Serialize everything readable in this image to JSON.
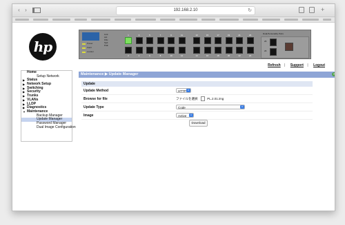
{
  "browser": {
    "url": "192.168.2.10",
    "back_icon": "chevron-left-icon",
    "forward_icon": "chevron-right-icon",
    "reload_icon": "reload-icon"
  },
  "header": {
    "logo_text": "hp",
    "switch_labels": {
      "mode_lines": [
        "Link",
        "Act",
        "FDx",
        "Spd",
        "PoE"
      ],
      "led_labels": [
        "Power",
        "Fault",
        "Locator"
      ],
      "sfp_title": "Dual-Personality Ports",
      "sfp_ports": [
        "25",
        "26"
      ]
    },
    "port_numbers_top": [
      "1",
      "3",
      "5",
      "7",
      "9",
      "11",
      "13",
      "15",
      "17",
      "19",
      "21",
      "23"
    ],
    "port_numbers_bottom": [
      "2",
      "4",
      "6",
      "8",
      "10",
      "12",
      "14",
      "16",
      "18",
      "20",
      "22",
      "24"
    ],
    "active_port": "1"
  },
  "top_links": {
    "refresh": "Refresh",
    "support": "Support",
    "logout": "Logout"
  },
  "nav": {
    "items": [
      {
        "label": "Home",
        "arrow": ""
      },
      {
        "label": "Setup Network",
        "sub": true
      },
      {
        "label": "Status",
        "arrow": "▶"
      },
      {
        "label": "Network Setup",
        "arrow": "▶"
      },
      {
        "label": "Switching",
        "arrow": "▶"
      },
      {
        "label": "Security",
        "arrow": "▶"
      },
      {
        "label": "Trunks",
        "arrow": "▶"
      },
      {
        "label": "VLANs",
        "arrow": "▶"
      },
      {
        "label": "LLDP",
        "arrow": "▶"
      },
      {
        "label": "Diagnostics",
        "arrow": "▶"
      },
      {
        "label": "Maintenance",
        "arrow": "▼"
      },
      {
        "label": "Backup Manager",
        "sub": true
      },
      {
        "label": "Update Manager",
        "sub": true,
        "selected": true
      },
      {
        "label": "Password Manager",
        "sub": true
      },
      {
        "label": "Dual Image Configuration",
        "sub": true
      }
    ]
  },
  "main": {
    "title": "Maintenance ▶ Update Manager",
    "section_title": "Update",
    "fields": {
      "method_label": "Update Method",
      "method_value": "HTTP",
      "browse_label": "Browse for file",
      "browse_button": "ファイルを選択",
      "browse_file": "PL.2.01.img",
      "type_label": "Update Type",
      "type_value": "Code",
      "image_label": "Image",
      "image_value": "Active"
    },
    "download_label": "Download"
  }
}
